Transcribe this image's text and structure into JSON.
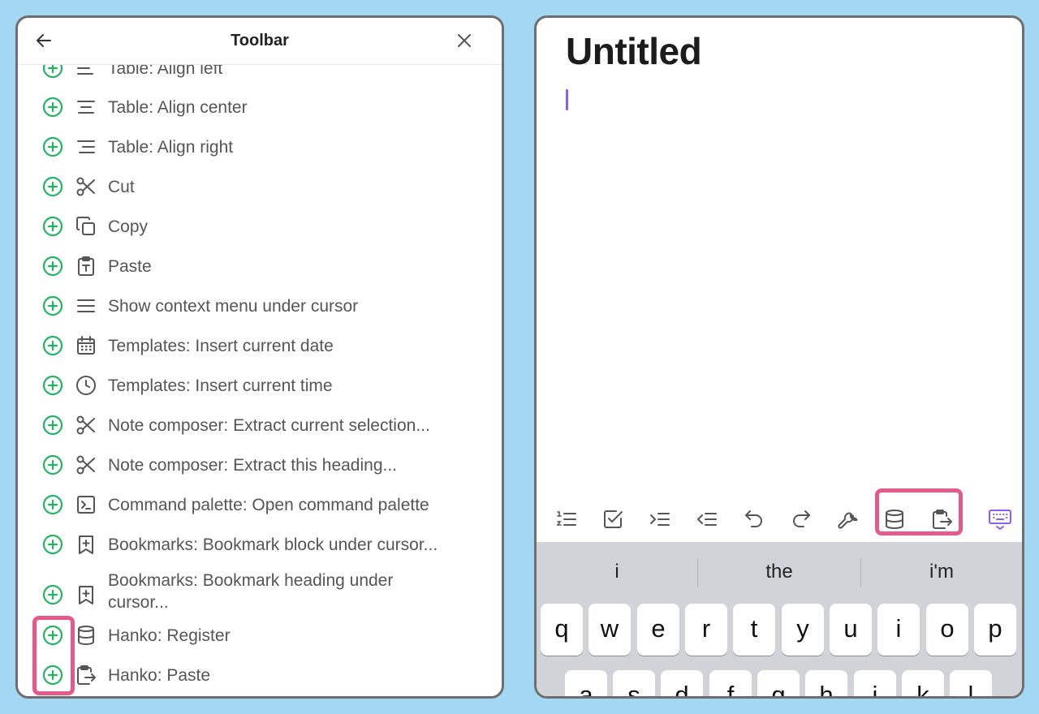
{
  "left_panel": {
    "title": "Toolbar",
    "items": [
      {
        "label": "Table: Align left",
        "icon": "align-left-icon"
      },
      {
        "label": "Table: Align center",
        "icon": "align-center-icon"
      },
      {
        "label": "Table: Align right",
        "icon": "align-right-icon"
      },
      {
        "label": "Cut",
        "icon": "scissors-icon"
      },
      {
        "label": "Copy",
        "icon": "copy-icon"
      },
      {
        "label": "Paste",
        "icon": "clipboard-type-icon"
      },
      {
        "label": "Show context menu under cursor",
        "icon": "menu-icon"
      },
      {
        "label": "Templates: Insert current date",
        "icon": "calendar-icon"
      },
      {
        "label": "Templates: Insert current time",
        "icon": "clock-icon"
      },
      {
        "label": "Note composer: Extract current selection...",
        "icon": "scissors-icon"
      },
      {
        "label": "Note composer: Extract this heading...",
        "icon": "scissors-icon"
      },
      {
        "label": "Command palette: Open command palette",
        "icon": "terminal-icon"
      },
      {
        "label": "Bookmarks: Bookmark block under cursor...",
        "icon": "bookmark-plus-icon"
      },
      {
        "label": "Bookmarks: Bookmark heading under cursor...",
        "icon": "bookmark-plus-icon"
      },
      {
        "label": "Hanko: Register",
        "icon": "database-icon"
      },
      {
        "label": "Hanko: Paste",
        "icon": "clipboard-export-icon"
      }
    ]
  },
  "editor": {
    "title": "Untitled",
    "toolbar_icons": [
      "numbered-list-icon",
      "checkbox-icon",
      "indent-icon",
      "outdent-icon",
      "undo-icon",
      "redo-icon",
      "wrench-icon",
      "database-icon",
      "clipboard-export-icon",
      "keyboard-hide-icon"
    ]
  },
  "keyboard": {
    "suggestions": [
      "i",
      "the",
      "i'm"
    ],
    "row1": [
      "q",
      "w",
      "e",
      "r",
      "t",
      "y",
      "u",
      "i",
      "o",
      "p"
    ],
    "row2": [
      "a",
      "s",
      "d",
      "f",
      "g",
      "h",
      "j",
      "k",
      "l"
    ]
  },
  "colors": {
    "accent_green": "#22b561",
    "highlight_pink": "#e55a8a",
    "cursor_purple": "#8b5cf6",
    "background_blue": "#a3d8f4"
  }
}
